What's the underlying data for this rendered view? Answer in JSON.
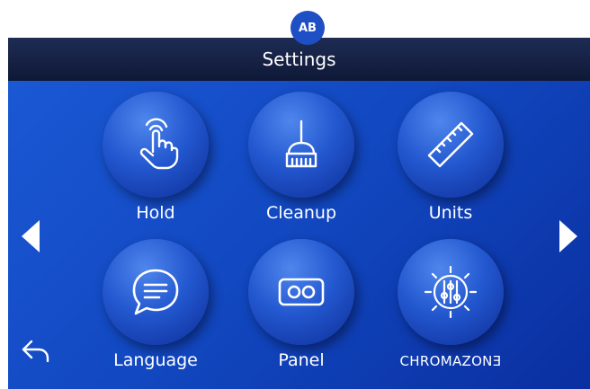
{
  "header": {
    "badge": "AB",
    "title": "Settings"
  },
  "tiles": [
    {
      "label": "Hold",
      "icon": "hand-pointer-icon"
    },
    {
      "label": "Cleanup",
      "icon": "broom-icon"
    },
    {
      "label": "Units",
      "icon": "ruler-icon"
    },
    {
      "label": "Language",
      "icon": "speech-bubble-icon"
    },
    {
      "label": "Panel",
      "icon": "panel-icon"
    },
    {
      "label": "CHROMAZONƎ",
      "icon": "sliders-sun-icon"
    }
  ],
  "nav": {
    "prev": "arrow-left-icon",
    "next": "arrow-right-icon",
    "back": "back-icon"
  },
  "colors": {
    "background": "#1b58d4",
    "titlebar": "#1e2c54",
    "badge": "#1f4fc4",
    "text": "#ffffff"
  }
}
